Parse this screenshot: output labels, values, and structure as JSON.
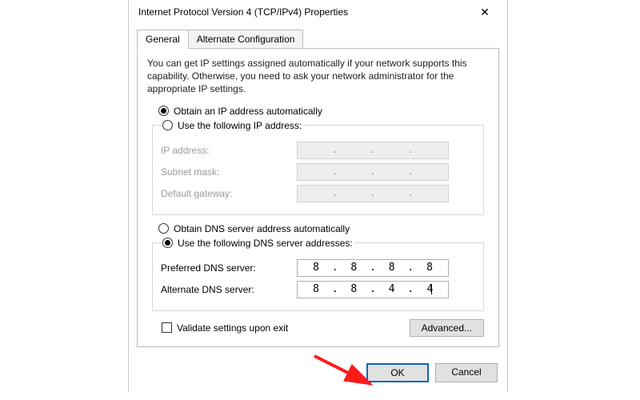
{
  "window": {
    "title": "Internet Protocol Version 4 (TCP/IPv4) Properties",
    "close_glyph": "✕"
  },
  "tabs": {
    "general": "General",
    "alternate": "Alternate Configuration"
  },
  "intro": "You can get IP settings assigned automatically if your network supports this capability. Otherwise, you need to ask your network administrator for the appropriate IP settings.",
  "ip": {
    "auto_label": "Obtain an IP address automatically",
    "manual_label": "Use the following IP address:",
    "fields": {
      "ip_address": "IP address:",
      "subnet_mask": "Subnet mask:",
      "default_gateway": "Default gateway:"
    }
  },
  "dns": {
    "auto_label": "Obtain DNS server address automatically",
    "manual_label": "Use the following DNS server addresses:",
    "preferred_label": "Preferred DNS server:",
    "alternate_label": "Alternate DNS server:",
    "preferred": {
      "a": "8",
      "b": "8",
      "c": "8",
      "d": "8"
    },
    "alternate": {
      "a": "8",
      "b": "8",
      "c": "4",
      "d": "4"
    }
  },
  "validate_label": "Validate settings upon exit",
  "buttons": {
    "advanced": "Advanced...",
    "ok": "OK",
    "cancel": "Cancel"
  }
}
